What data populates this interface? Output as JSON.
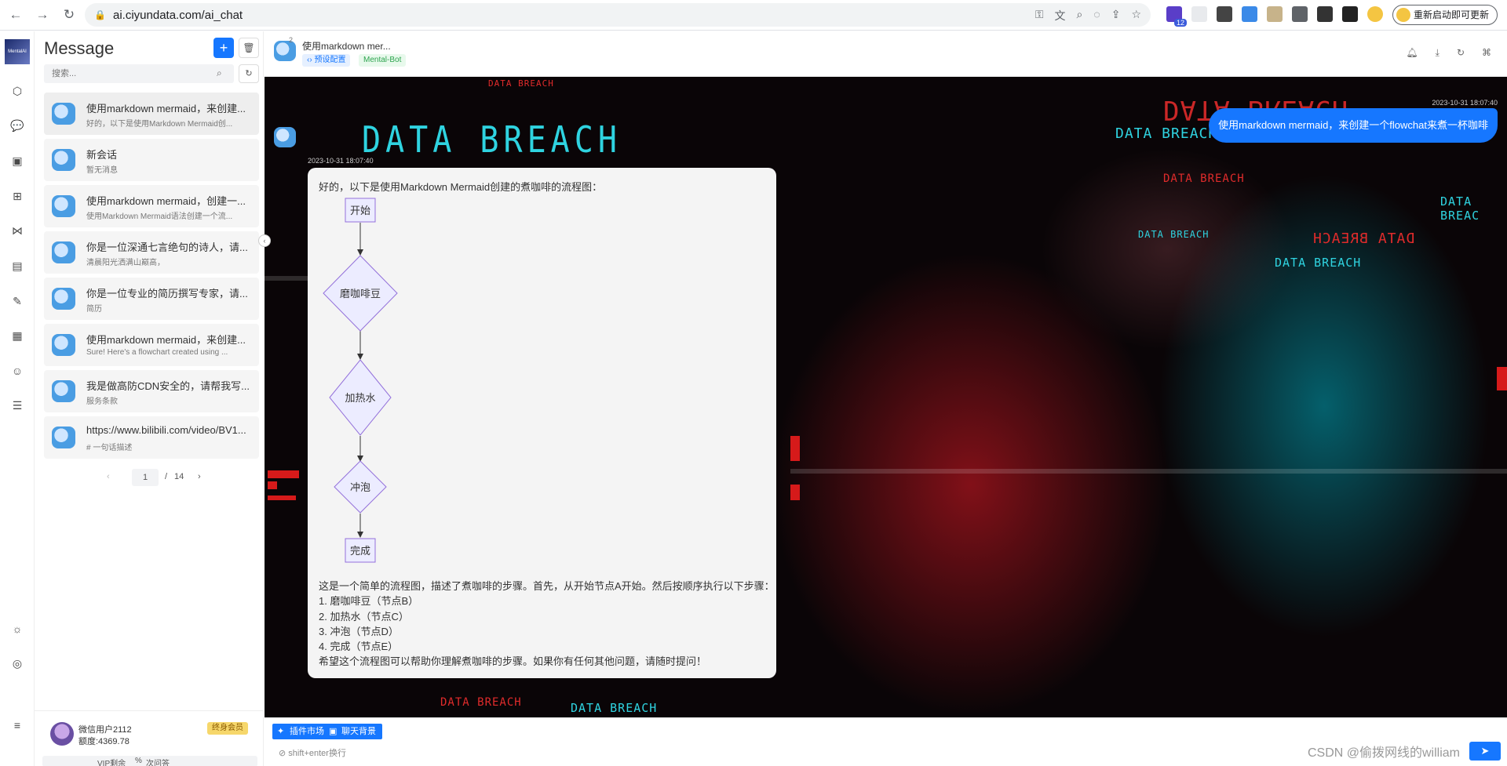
{
  "browser": {
    "url": "ai.ciyundata.com/ai_chat",
    "restart_label": "重新启动即可更新",
    "ext_badge": "12"
  },
  "rail": {
    "logo_text": "MentalAI"
  },
  "sidebar": {
    "title": "Message",
    "search_placeholder": "搜索...",
    "sessions": [
      {
        "title": "使用markdown mermaid，来创建...",
        "preview": "好的，以下是使用Markdown Mermaid创..."
      },
      {
        "title": "新会话",
        "preview": "暂无消息"
      },
      {
        "title": "使用markdown mermaid，创建一...",
        "preview": "使用Markdown Mermaid语法创建一个流..."
      },
      {
        "title": "你是一位深通七言绝句的诗人，请...",
        "preview": "清晨阳光洒满山巅高，"
      },
      {
        "title": "你是一位专业的简历撰写专家，请...",
        "preview": "简历"
      },
      {
        "title": "使用markdown mermaid，来创建...",
        "preview": "Sure! Here's a flowchart created using ..."
      },
      {
        "title": "我是做高防CDN安全的，请帮我写...",
        "preview": "服务条款"
      },
      {
        "title": "https://www.bilibili.com/video/BV1...",
        "preview": "# 一句话描述"
      }
    ],
    "pager": {
      "current": "1",
      "separator": "/",
      "total": "14"
    },
    "user": {
      "name": "微信用户2112",
      "balance": "额度:4369.78",
      "badge": "终身会员",
      "usage_left": "VIP剩余",
      "usage_pct": "%",
      "usage_right": "次问答"
    }
  },
  "header": {
    "count": "2",
    "title": "使用markdown mer...",
    "preset_tag": "预设配置",
    "model_tag": "Mental-Bot"
  },
  "chat": {
    "user_time": "2023-10-31 18:07:40",
    "user_message": "使用markdown mermaid，来创建一个flowchat来煮一杯咖啡",
    "bot_time": "2023-10-31 18:07:40",
    "bot_intro": "好的，以下是使用Markdown Mermaid创建的煮咖啡的流程图：",
    "flow_nodes": {
      "start": "开始",
      "grind": "磨咖啡豆",
      "boil": "加热水",
      "brew": "冲泡",
      "done": "完成"
    },
    "bot_summary": [
      "这是一个简单的流程图，描述了煮咖啡的步骤。首先，从开始节点A开始。然后按顺序执行以下步骤：",
      "1. 磨咖啡豆（节点B）",
      "2. 加热水（节点C）",
      "3. 冲泡（节点D）",
      "4. 完成（节点E）",
      "希望这个流程图可以帮助你理解煮咖啡的步骤。如果你有任何其他问题，请随时提问！"
    ]
  },
  "background_text": {
    "breach_1": "DATA BREACH",
    "breach_2": "DATA BREACH",
    "breach_3": "DATA BREACH",
    "breach_4": "DATA BREACH",
    "breach_5": "DATA BREACH",
    "breach_6": "DATA BREACH",
    "breach_7": "DATA BREACH",
    "breach_8": "DATA BREAC",
    "breach_9": "DATA BREACH",
    "breach_10": "DATA BREACH",
    "breach_11": "DATA BREACH"
  },
  "composer": {
    "plugin_market": "插件市场",
    "chat_background": "聊天背景",
    "hint": "shift+enter换行",
    "watermark": "CSDN @偷拨网线的william"
  },
  "colors": {
    "accent": "#1677ff",
    "glitch_red": "#e02b2b",
    "glitch_cyan": "#2fd3e0"
  }
}
